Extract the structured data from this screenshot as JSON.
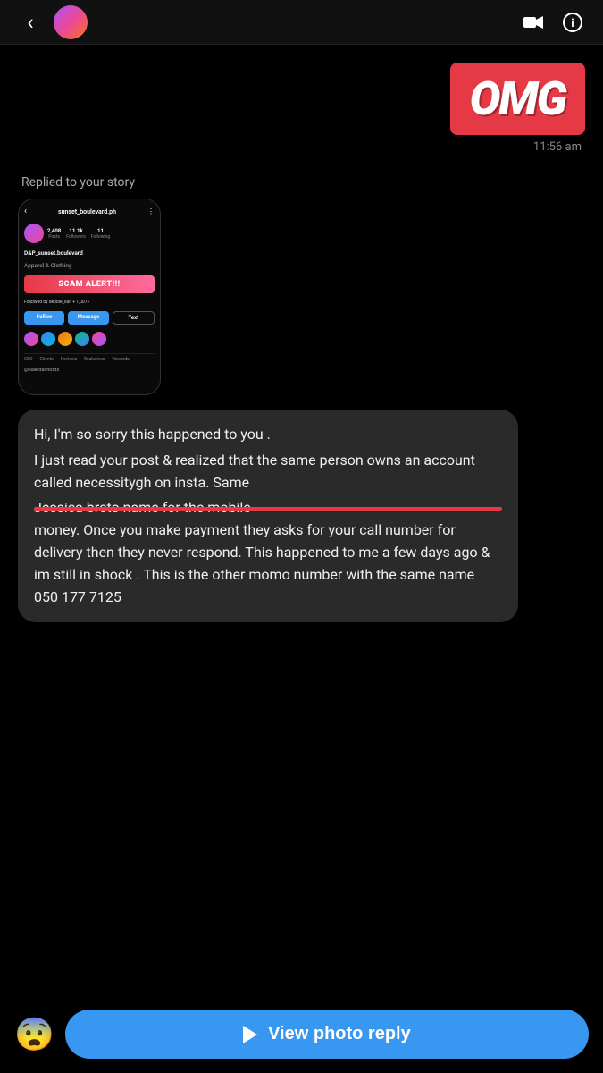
{
  "topBar": {
    "backArrow": "‹",
    "avatarEmoji": "👤",
    "icon1": "☰",
    "icon2": "☎"
  },
  "messages": {
    "omgSticker": "OMG",
    "timestamp": "11:56 am",
    "repliedLabel": "Replied to your story",
    "storyMock": {
      "username": "sunset_boulevard.ph",
      "backArrow": "‹",
      "menuDots": "⋮",
      "posts": "2,408",
      "postsLabel": "Posts",
      "followers": "11.1k",
      "followersLabel": "Followers",
      "following": "11",
      "followingLabel": "Following",
      "displayName": "D&P_sunset.boulevard",
      "subName": "Apparel & Clothing",
      "scamAlert": "SCAM ALERT!!!",
      "followedBy": "Followed by debbie_xalt + 1,007+",
      "followBtn": "Follow",
      "messageBtn": "Message",
      "textBtn": "Text",
      "postLabel": "@kaleidachords"
    },
    "messageText": "Hi, I'm so sorry this happened to you .\nI just read your post & realized that the same person owns an account called necessitygh on insta. Same Jessica breto name for the mobile money. Once you make payment they asks for your call number for delivery then they never respond. This happened to me a few days ago & im still in shock . This is the other momo number with the same name 050 177 7125",
    "highlightedText": "Jessica breto name for the mobile"
  },
  "bottomBar": {
    "emoji": "😨",
    "viewPhotoReplyLabel": "▶ View photo reply",
    "playIcon": "▶",
    "buttonText": "View photo reply"
  }
}
